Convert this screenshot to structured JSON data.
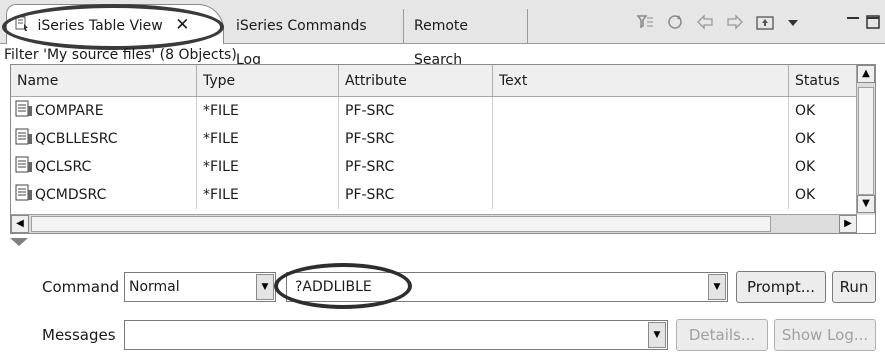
{
  "tabs": [
    {
      "label": "iSeries Table View",
      "active": true,
      "close": "✕"
    },
    {
      "label": "iSeries Commands Log",
      "active": false
    },
    {
      "label": "Remote Search",
      "active": false
    }
  ],
  "toolbar": {
    "icons": [
      "filter-icon",
      "refresh-icon",
      "back-arrow-icon",
      "forward-arrow-icon",
      "up-folder-icon",
      "view-menu-icon",
      "minimize-icon",
      "maximize-icon"
    ]
  },
  "filter_label": "Filter 'My source files' (8 Objects)",
  "table": {
    "headers": [
      "Name",
      "Type",
      "Attribute",
      "Text",
      "Status"
    ],
    "rows": [
      {
        "name": "COMPARE",
        "type": "*FILE",
        "attribute": "PF-SRC",
        "text": "",
        "status": "OK"
      },
      {
        "name": "QCBLLESRC",
        "type": "*FILE",
        "attribute": "PF-SRC",
        "text": "",
        "status": "OK"
      },
      {
        "name": "QCLSRC",
        "type": "*FILE",
        "attribute": "PF-SRC",
        "text": "",
        "status": "OK"
      },
      {
        "name": "QCMDSRC",
        "type": "*FILE",
        "attribute": "PF-SRC",
        "text": "",
        "status": "OK"
      }
    ]
  },
  "command": {
    "label": "Command",
    "mode": "Normal",
    "value": "?ADDLIBLE",
    "prompt_button": "Prompt...",
    "run_button": "Run"
  },
  "messages": {
    "label": "Messages",
    "value": "",
    "details_button": "Details...",
    "showlog_button": "Show Log..."
  },
  "colors": {
    "annotation": "#2e2e2e",
    "tab_bg": "#e6e6e6",
    "header_bg": "#efefef",
    "disabled_text": "#a0a0a0"
  }
}
